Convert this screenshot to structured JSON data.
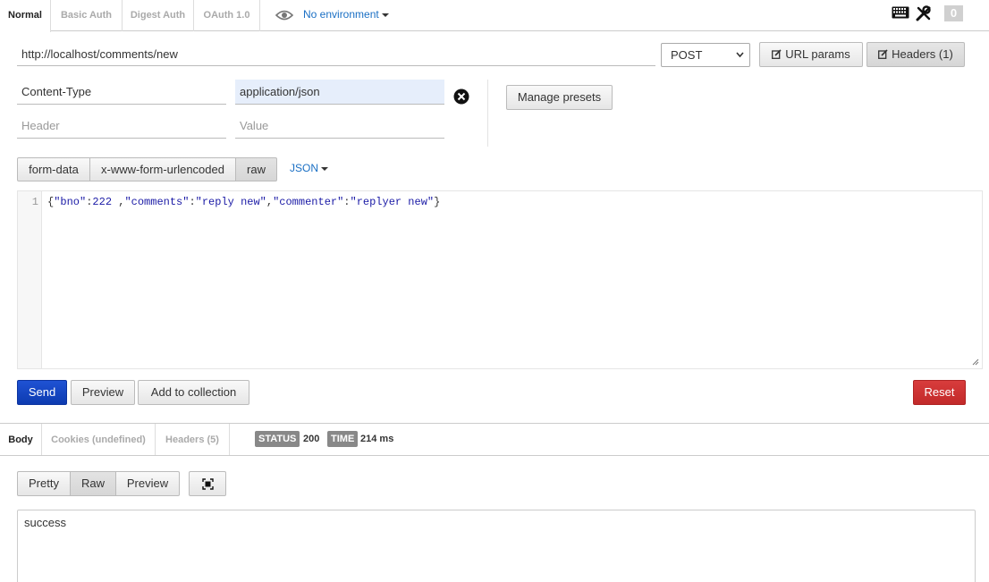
{
  "auth_tabs": [
    "Normal",
    "Basic Auth",
    "Digest Auth",
    "OAuth 1.0"
  ],
  "environment": {
    "label": "No environment"
  },
  "tools": {
    "counter": "0"
  },
  "request": {
    "url": "http://localhost/comments/new",
    "method": "POST",
    "url_params_label": "URL params",
    "headers_label": "Headers (1)"
  },
  "headers": {
    "rows": [
      {
        "key": "Content-Type",
        "value": "application/json"
      }
    ],
    "key_placeholder": "Header",
    "value_placeholder": "Value",
    "manage_presets_label": "Manage presets"
  },
  "body_types": [
    "form-data",
    "x-www-form-urlencoded",
    "raw"
  ],
  "raw_format": "JSON",
  "editor": {
    "line_number": "1",
    "tokens": [
      "{",
      "\"bno\"",
      ":",
      "222",
      " ,",
      "\"comments\"",
      ":",
      "\"reply new\"",
      ",",
      "\"commenter\"",
      ":",
      "\"replyer new\"",
      "}"
    ]
  },
  "actions": {
    "send": "Send",
    "preview": "Preview",
    "add_to_collection": "Add to collection",
    "reset": "Reset"
  },
  "response_tabs": [
    "Body",
    "Cookies (undefined)",
    "Headers (5)"
  ],
  "status": {
    "status_label": "STATUS",
    "status_value": "200",
    "time_label": "TIME",
    "time_value": "214 ms"
  },
  "response_views": [
    "Pretty",
    "Raw",
    "Preview"
  ],
  "response_body": "success",
  "colors": {
    "send": "#1546c4",
    "reset": "#cc3333",
    "link": "#1a6fc4"
  }
}
